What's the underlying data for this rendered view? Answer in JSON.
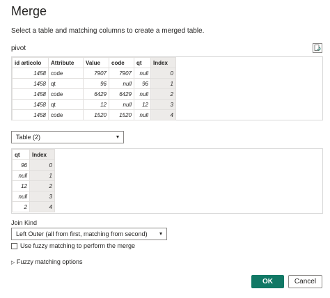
{
  "dialog": {
    "title": "Merge",
    "subtitle": "Select a table and matching columns to create a merged table."
  },
  "first_table": {
    "name": "pivot",
    "columns": [
      "id articolo",
      "Attribute",
      "Value",
      "code",
      "qt",
      "Index"
    ],
    "rows": [
      [
        "1458",
        "code",
        "7907",
        "7907",
        "null",
        "0"
      ],
      [
        "1458",
        "qt",
        "96",
        "null",
        "96",
        "1"
      ],
      [
        "1458",
        "code",
        "6429",
        "6429",
        "null",
        "2"
      ],
      [
        "1458",
        "qt",
        "12",
        "null",
        "12",
        "3"
      ],
      [
        "1458",
        "code",
        "1520",
        "1520",
        "null",
        "4"
      ]
    ]
  },
  "second_table": {
    "selected": "Table (2)",
    "columns": [
      "qt",
      "Index"
    ],
    "rows": [
      [
        "96",
        "0"
      ],
      [
        "null",
        "1"
      ],
      [
        "12",
        "2"
      ],
      [
        "null",
        "3"
      ],
      [
        "2",
        "4"
      ]
    ]
  },
  "join": {
    "label": "Join Kind",
    "selected": "Left Outer (all from first, matching from second)"
  },
  "fuzzy": {
    "checkbox_label": "Use fuzzy matching to perform the merge",
    "checked": false,
    "options_label": "Fuzzy matching options"
  },
  "buttons": {
    "ok": "OK",
    "cancel": "Cancel"
  },
  "colors": {
    "accent": "#117865",
    "index_column_bg": "#edebe9"
  }
}
